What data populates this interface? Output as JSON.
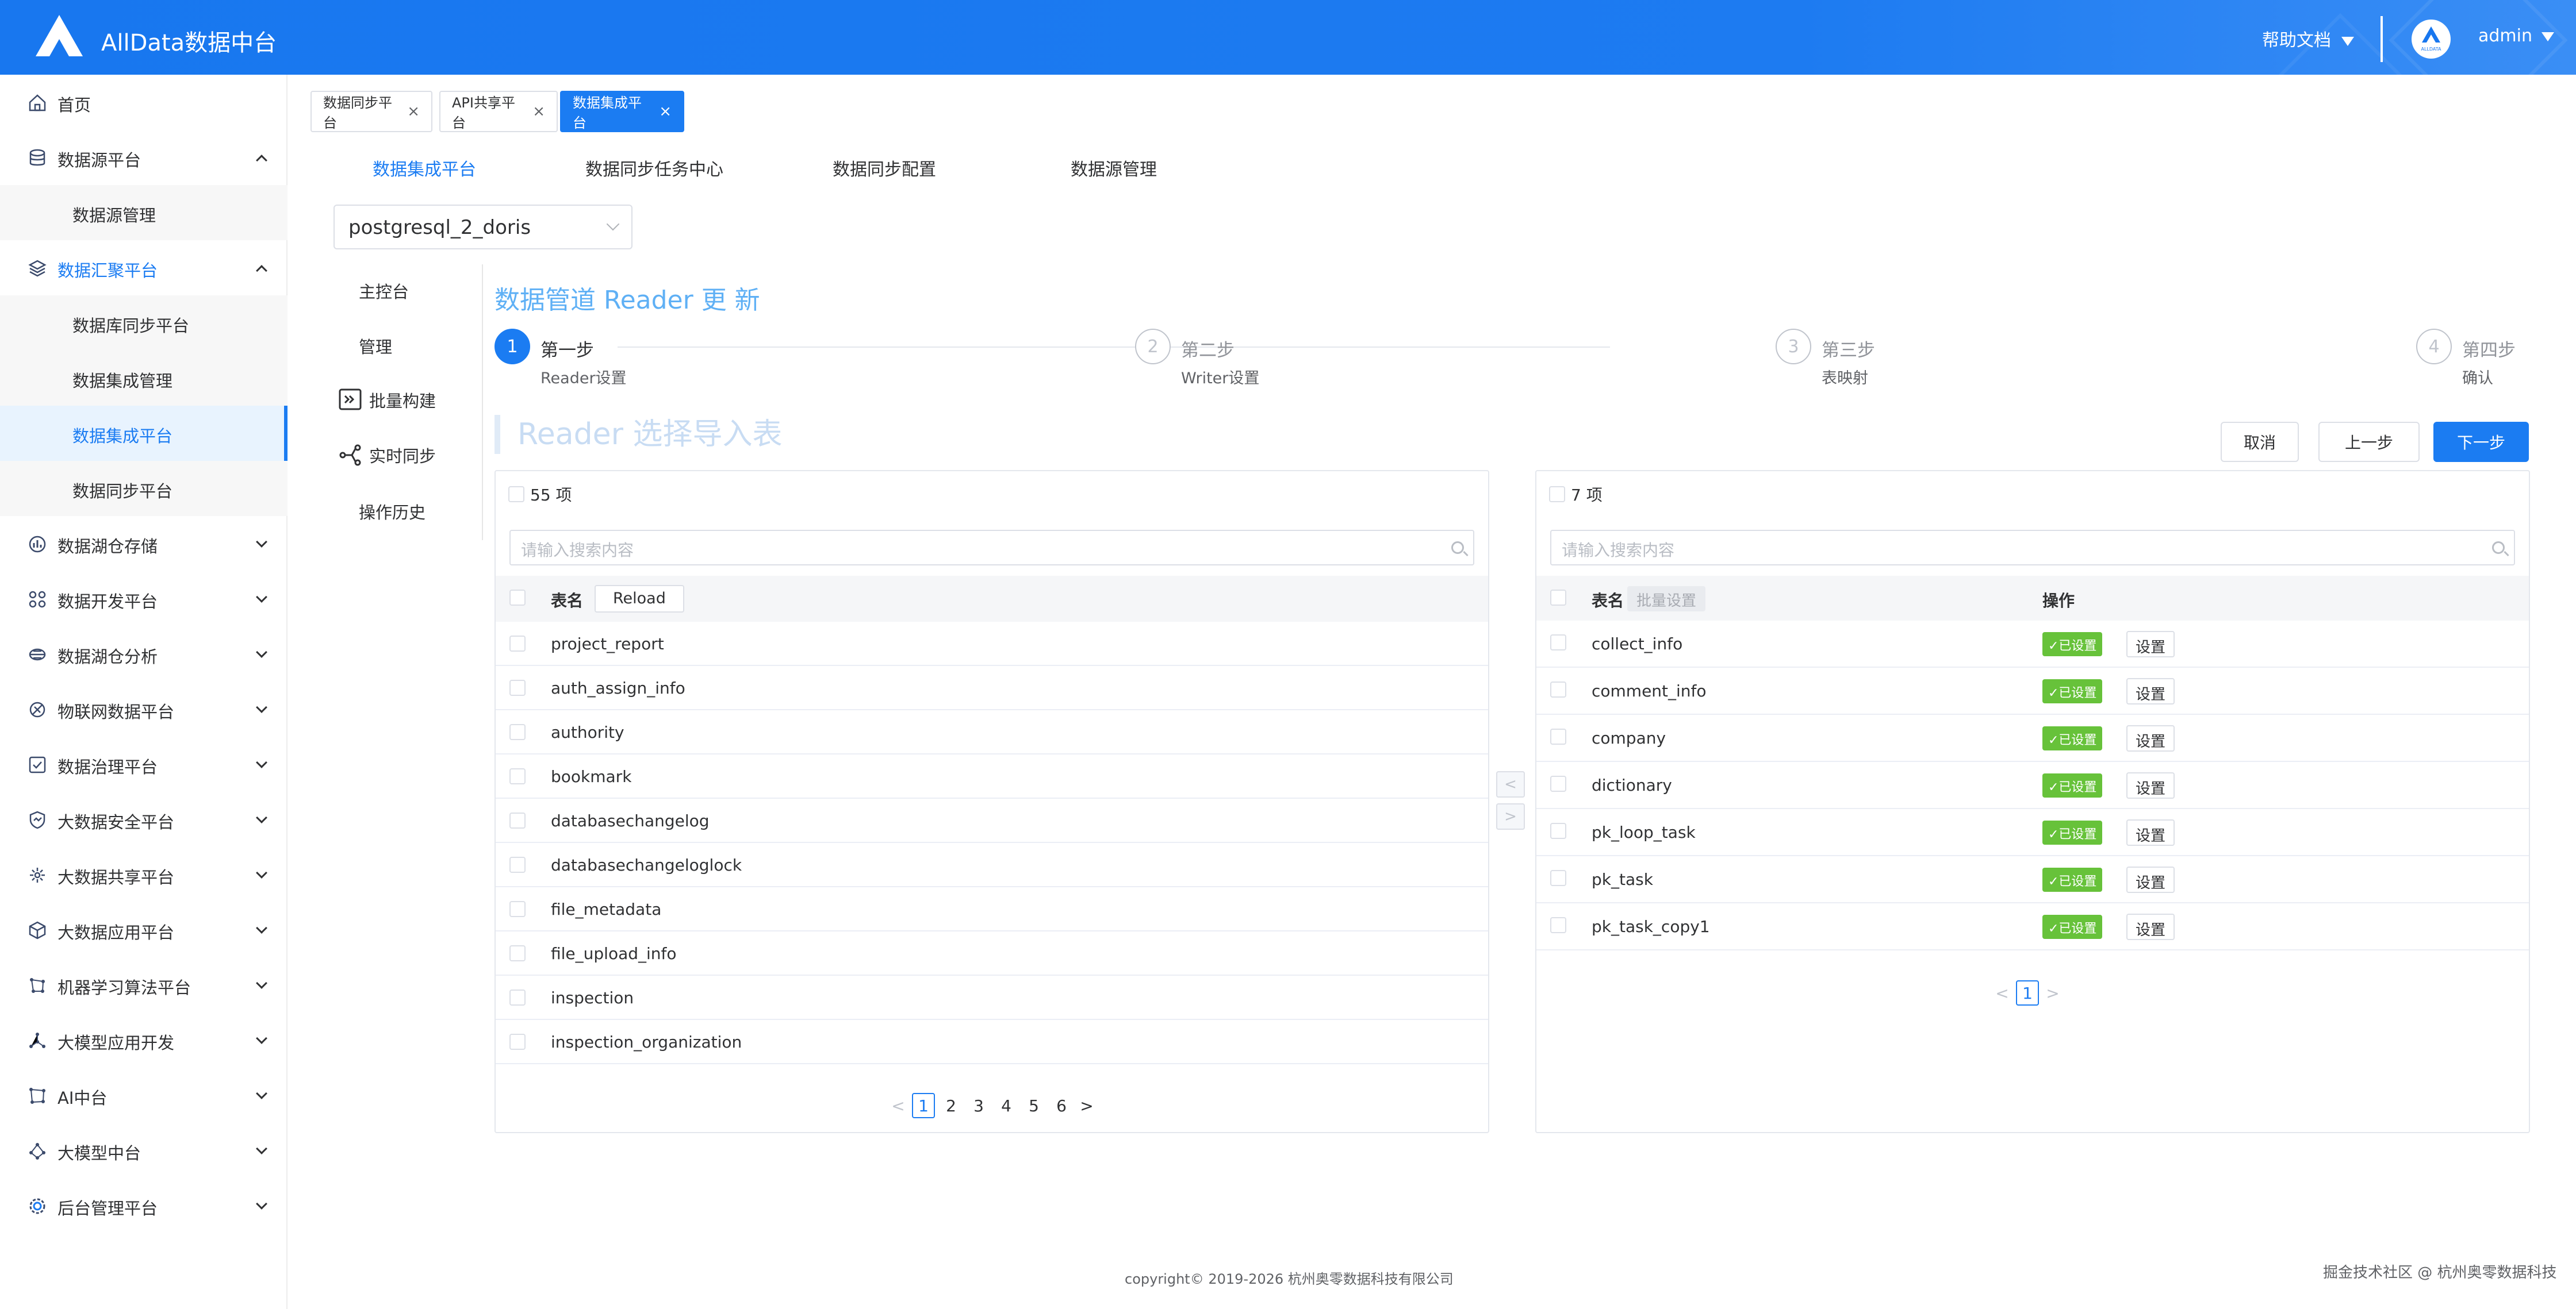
{
  "header": {
    "app_title": "AllData数据中台",
    "help_label": "帮助文档",
    "user_name": "admin",
    "avatar_text": "ALLDATA",
    "brand_color": "#1b7cf2"
  },
  "sidebar": {
    "items": [
      {
        "label": "首页",
        "icon": "home-icon"
      },
      {
        "label": "数据源平台",
        "icon": "database-icon",
        "expanded": true
      },
      {
        "label": "数据源管理",
        "sub": true
      },
      {
        "label": "数据汇聚平台",
        "icon": "layers-icon",
        "expanded": true
      },
      {
        "label": "数据库同步平台",
        "sub": true
      },
      {
        "label": "数据集成管理",
        "sub": true
      },
      {
        "label": "数据集成平台",
        "sub": true,
        "active": true
      },
      {
        "label": "数据同步平台",
        "sub": true
      },
      {
        "label": "数据湖仓存储",
        "icon": "bar-chart-icon"
      },
      {
        "label": "数据开发平台",
        "icon": "apps-icon"
      },
      {
        "label": "数据湖仓分析",
        "icon": "analysis-icon"
      },
      {
        "label": "物联网数据平台",
        "icon": "iot-icon"
      },
      {
        "label": "数据治理平台",
        "icon": "checklist-icon"
      },
      {
        "label": "大数据安全平台",
        "icon": "shield-icon"
      },
      {
        "label": "大数据共享平台",
        "icon": "share-icon"
      },
      {
        "label": "大数据应用平台",
        "icon": "cube-icon"
      },
      {
        "label": "机器学习算法平台",
        "icon": "nodes-icon"
      },
      {
        "label": "大模型应用开发",
        "icon": "graph-icon"
      },
      {
        "label": "AI中台",
        "icon": "ai-icon"
      },
      {
        "label": "大模型中台",
        "icon": "model-icon"
      },
      {
        "label": "后台管理平台",
        "icon": "settings-icon"
      }
    ]
  },
  "tags": [
    {
      "label": "数据同步平台",
      "close": "×"
    },
    {
      "label": "API共享平台",
      "close": "×"
    },
    {
      "label": "数据集成平台",
      "close": "×",
      "active": true
    }
  ],
  "top_tabs": [
    "数据集成平台",
    "数据同步任务中心",
    "数据同步配置",
    "数据源管理"
  ],
  "datasource_select": {
    "value": "postgresql_2_doris"
  },
  "subnav": [
    "主控台",
    "管理",
    "批量构建",
    "实时同步",
    "操作历史"
  ],
  "wizard": {
    "title": "数据管道 Reader 更 新",
    "steps": [
      {
        "num": "1",
        "title": "第一步",
        "desc": "Reader设置",
        "active": true
      },
      {
        "num": "2",
        "title": "第二步",
        "desc": "Writer设置"
      },
      {
        "num": "3",
        "title": "第三步",
        "desc": "表映射"
      },
      {
        "num": "4",
        "title": "第四步",
        "desc": "确认"
      }
    ],
    "section_title": "Reader 选择导入表",
    "buttons": {
      "cancel": "取消",
      "prev": "上一步",
      "next": "下一步"
    }
  },
  "left_panel": {
    "count_label": "55 项",
    "search_placeholder": "请输入搜索内容",
    "col_name": "表名",
    "reload_label": "Reload",
    "rows": [
      "project_report",
      "auth_assign_info",
      "authority",
      "bookmark",
      "databasechangelog",
      "databasechangeloglock",
      "file_metadata",
      "file_upload_info",
      "inspection",
      "inspection_organization"
    ],
    "pages": [
      "1",
      "2",
      "3",
      "4",
      "5",
      "6"
    ],
    "prev": "<",
    "next": ">"
  },
  "right_panel": {
    "count_label": "7 项",
    "search_placeholder": "请输入搜索内容",
    "col_name": "表名",
    "batch_label": "批量设置",
    "col_action": "操作",
    "status_label": "✓已设置",
    "set_label": "设置",
    "rows": [
      "collect_info",
      "comment_info",
      "company",
      "dictionary",
      "pk_loop_task",
      "pk_task",
      "pk_task_copy1"
    ],
    "pages": [
      "1"
    ],
    "prev": "<",
    "next": ">"
  },
  "transfer": {
    "left": "<",
    "right": ">"
  },
  "footer": {
    "copyright": "copyright© 2019-2026 杭州奥零数据科技有限公司",
    "watermark": "掘金技术社区 @ 杭州奥零数据科技"
  }
}
